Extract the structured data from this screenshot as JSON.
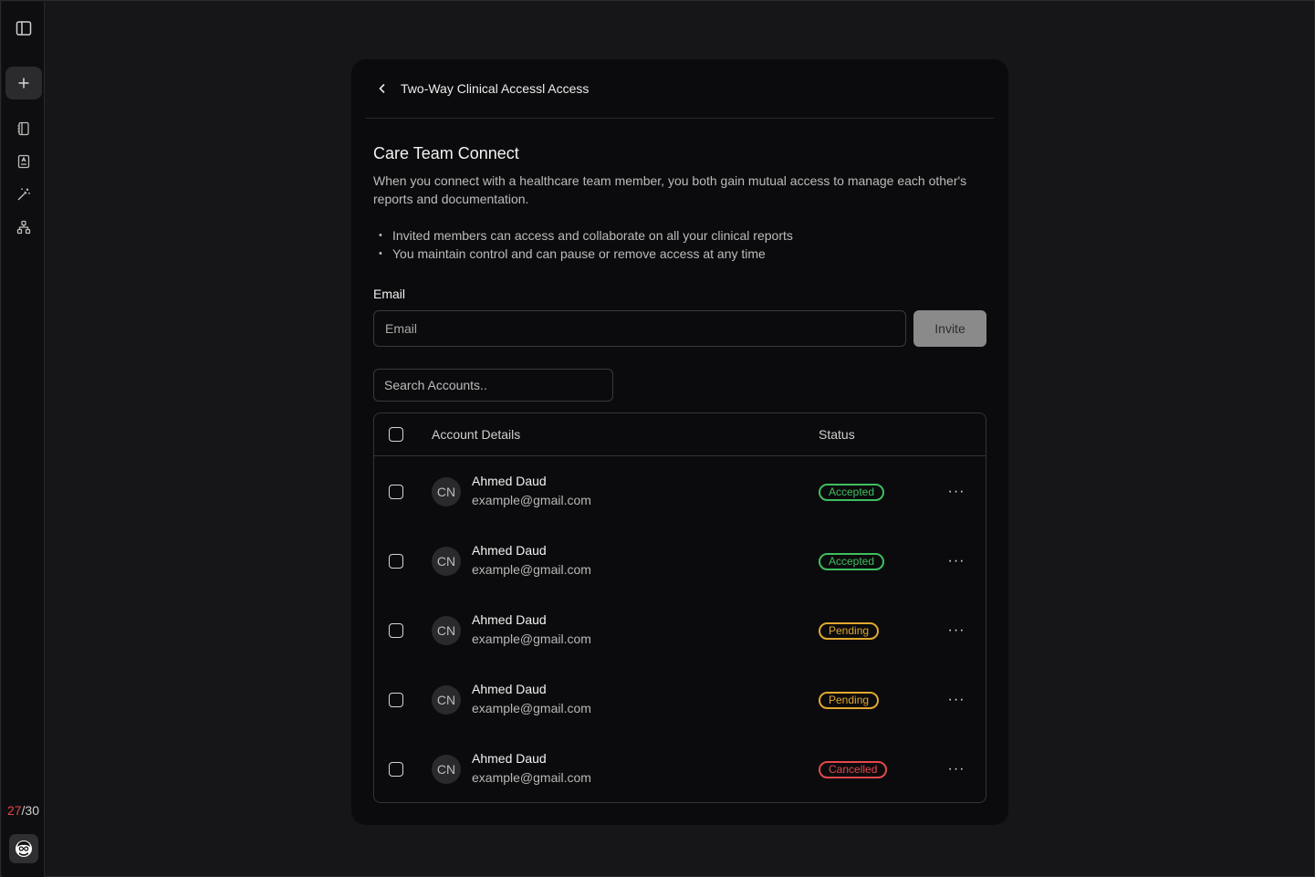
{
  "sidebar": {
    "quota_used": "27",
    "quota_total": "/30"
  },
  "header": {
    "title": "Two-Way Clinical Accessl Access"
  },
  "main": {
    "title": "Care Team Connect",
    "description": "When you connect with a healthcare team member, you both gain mutual access to manage each other's reports and documentation.",
    "bullets": [
      "Invited members can access and collaborate on all your clinical reports",
      "You maintain control and can pause or remove access at any time"
    ],
    "email_label": "Email",
    "email_placeholder": "Email",
    "invite_label": "Invite",
    "search_placeholder": "Search Accounts.."
  },
  "table": {
    "columns": [
      "Account Details",
      "Status"
    ],
    "rows": [
      {
        "initials": "CN",
        "name": "Ahmed Daud",
        "email": "example@gmail.com",
        "status": "Accepted"
      },
      {
        "initials": "CN",
        "name": "Ahmed Daud",
        "email": "example@gmail.com",
        "status": "Accepted"
      },
      {
        "initials": "CN",
        "name": "Ahmed Daud",
        "email": "example@gmail.com",
        "status": "Pending"
      },
      {
        "initials": "CN",
        "name": "Ahmed Daud",
        "email": "example@gmail.com",
        "status": "Pending"
      },
      {
        "initials": "CN",
        "name": "Ahmed Daud",
        "email": "example@gmail.com",
        "status": "Cancelled"
      }
    ],
    "more_label": "···"
  },
  "colors": {
    "accepted": "#3fbf5f",
    "pending": "#e0a82e",
    "cancelled": "#e5484d",
    "quota_used": "#e5484d"
  }
}
